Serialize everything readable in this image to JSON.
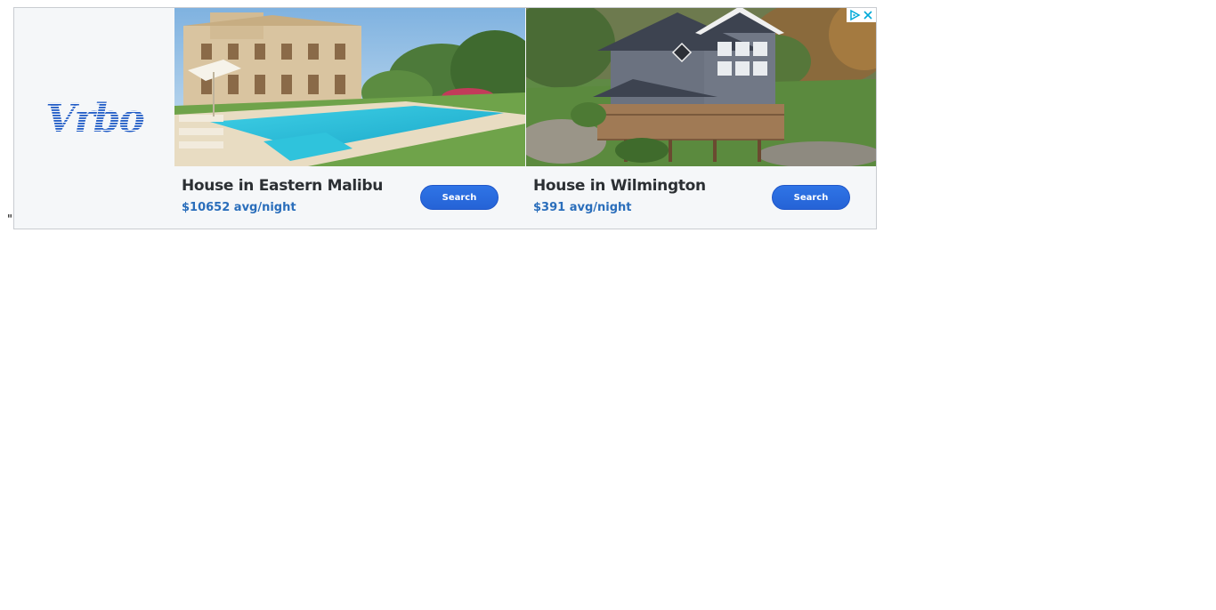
{
  "page": {
    "stray_text": "\""
  },
  "ad": {
    "brand": "Vrbo",
    "brand_color": "#1f5bc6",
    "button_color": "#2563d6",
    "price_color": "#2a6ebb",
    "adchoices_color": "#00a9d8",
    "listings": [
      {
        "title": "House in Eastern Malibu",
        "price": "$10652 avg/night",
        "button_label": "Search"
      },
      {
        "title": "House in Wilmington",
        "price": "$391 avg/night",
        "button_label": "Search"
      }
    ],
    "icons": {
      "adchoices": "adchoices-triangle-icon",
      "close": "close-x-icon"
    }
  }
}
